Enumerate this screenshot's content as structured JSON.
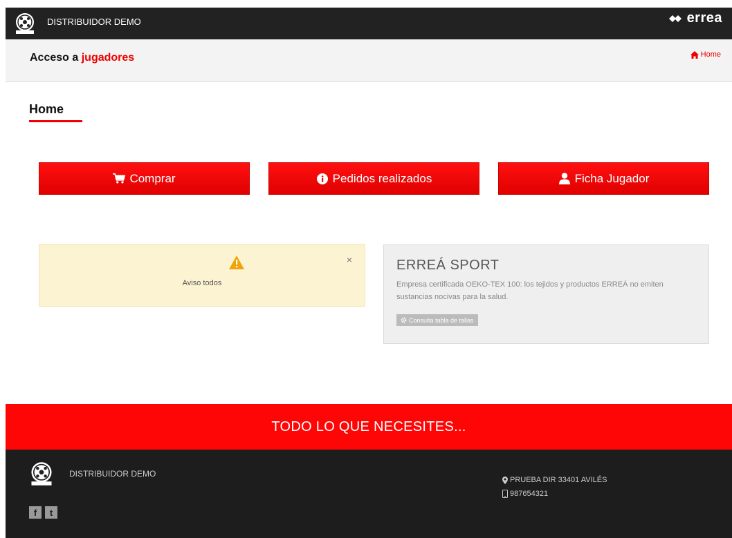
{
  "topbar": {
    "brand": "DISTRIBUIDOR DEMO",
    "logo_name": "errea"
  },
  "subheader": {
    "title_prefix": "Acceso a ",
    "title_accent": "jugadores",
    "breadcrumb": "Home"
  },
  "page": {
    "heading": "Home"
  },
  "actions": [
    {
      "label": "Comprar",
      "icon": "cart-icon"
    },
    {
      "label": "Pedidos realizados",
      "icon": "info-icon"
    },
    {
      "label": "Ficha Jugador",
      "icon": "user-icon"
    }
  ],
  "alert": {
    "message": "Aviso todos",
    "close": "×"
  },
  "card": {
    "title": "ERREÁ SPORT",
    "text": "Empresa certificada OEKO-TEX 100: los tejidos y productos ERREÁ no emiten sustancias nocivas para la salud.",
    "button": "Consulta tabla de tallas"
  },
  "banner": {
    "text": "TODO LO QUE NECESITES..."
  },
  "footer": {
    "brand": "DISTRIBUIDOR DEMO",
    "address": "PRUEBA DIR 33401 AVILÉS",
    "phone": "987654321",
    "social": [
      "f",
      "t"
    ]
  },
  "colors": {
    "accent": "#e00000",
    "alert_bg": "#fcf3d2",
    "footer_bg": "#1d1d1d",
    "topbar_bg": "#222222"
  }
}
